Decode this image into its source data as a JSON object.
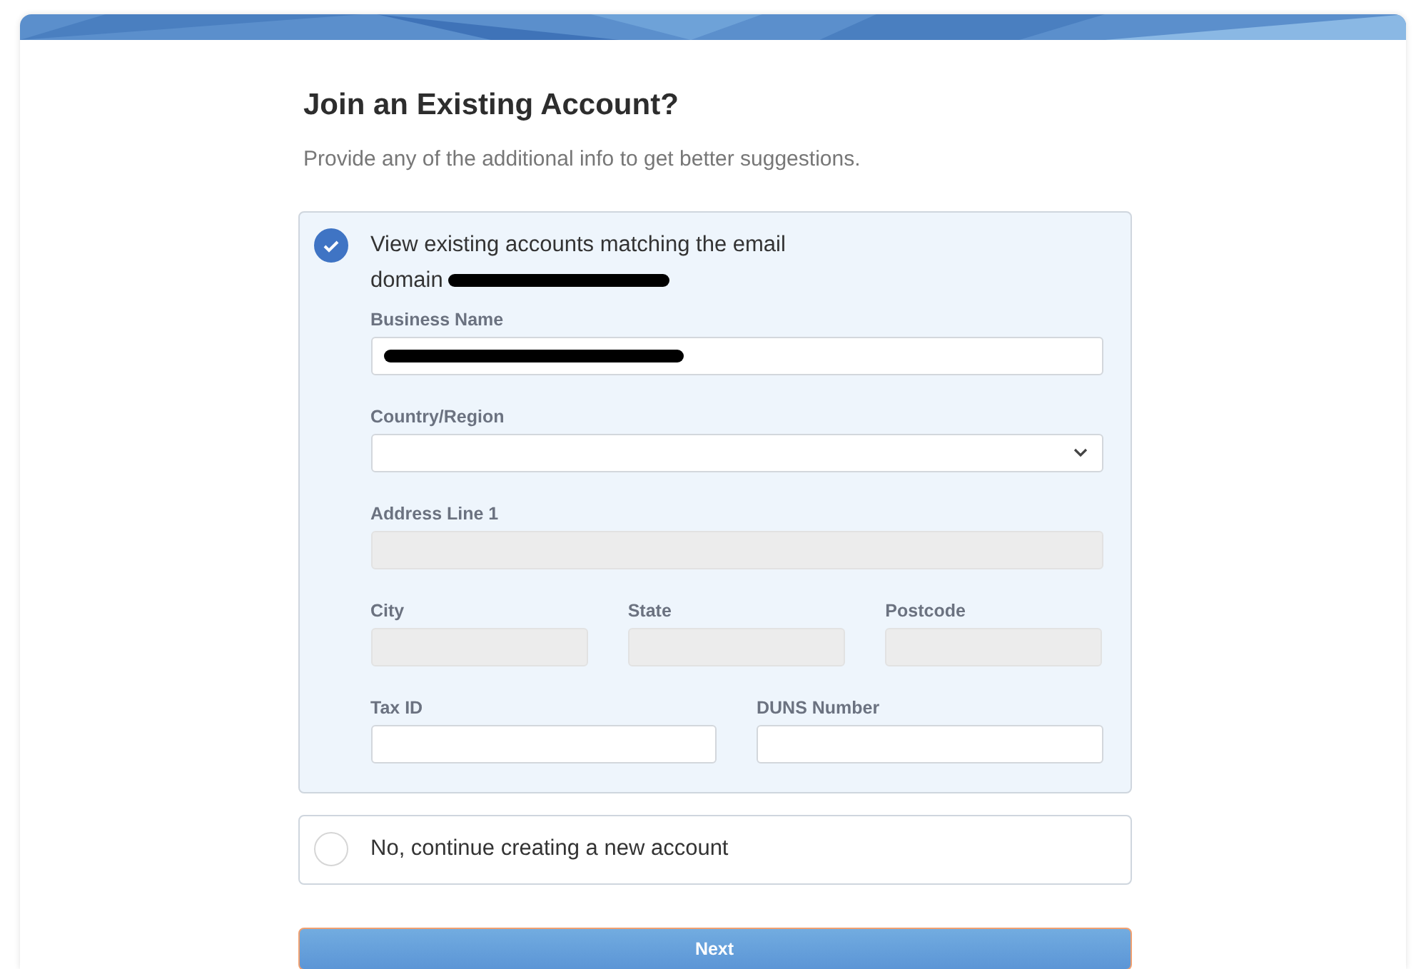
{
  "heading": "Join an Existing Account?",
  "subheading": "Provide any of the additional info to get better suggestions.",
  "options": [
    {
      "label": "View existing accounts matching the email domain",
      "selected": true,
      "redacted": true,
      "rows": [
        [
          {
            "label": "Business Name",
            "kind": "text",
            "disabled": false,
            "redacted": true
          }
        ],
        [
          {
            "label": "Country/Region",
            "kind": "select",
            "disabled": false,
            "redacted": false
          }
        ],
        [
          {
            "label": "Address Line 1",
            "kind": "text",
            "disabled": true,
            "redacted": false
          }
        ],
        [
          {
            "label": "City",
            "kind": "text",
            "disabled": true,
            "redacted": false
          },
          {
            "label": "State",
            "kind": "text",
            "disabled": true,
            "redacted": false
          },
          {
            "label": "Postcode",
            "kind": "text",
            "disabled": true,
            "redacted": false
          }
        ],
        [
          {
            "label": "Tax ID",
            "kind": "text",
            "disabled": false,
            "redacted": false
          },
          {
            "label": "DUNS Number",
            "kind": "text",
            "disabled": false,
            "redacted": false
          }
        ]
      ]
    },
    {
      "label": "No, continue creating a new account",
      "selected": false,
      "redacted": false
    }
  ],
  "button": {
    "label": "Next"
  }
}
